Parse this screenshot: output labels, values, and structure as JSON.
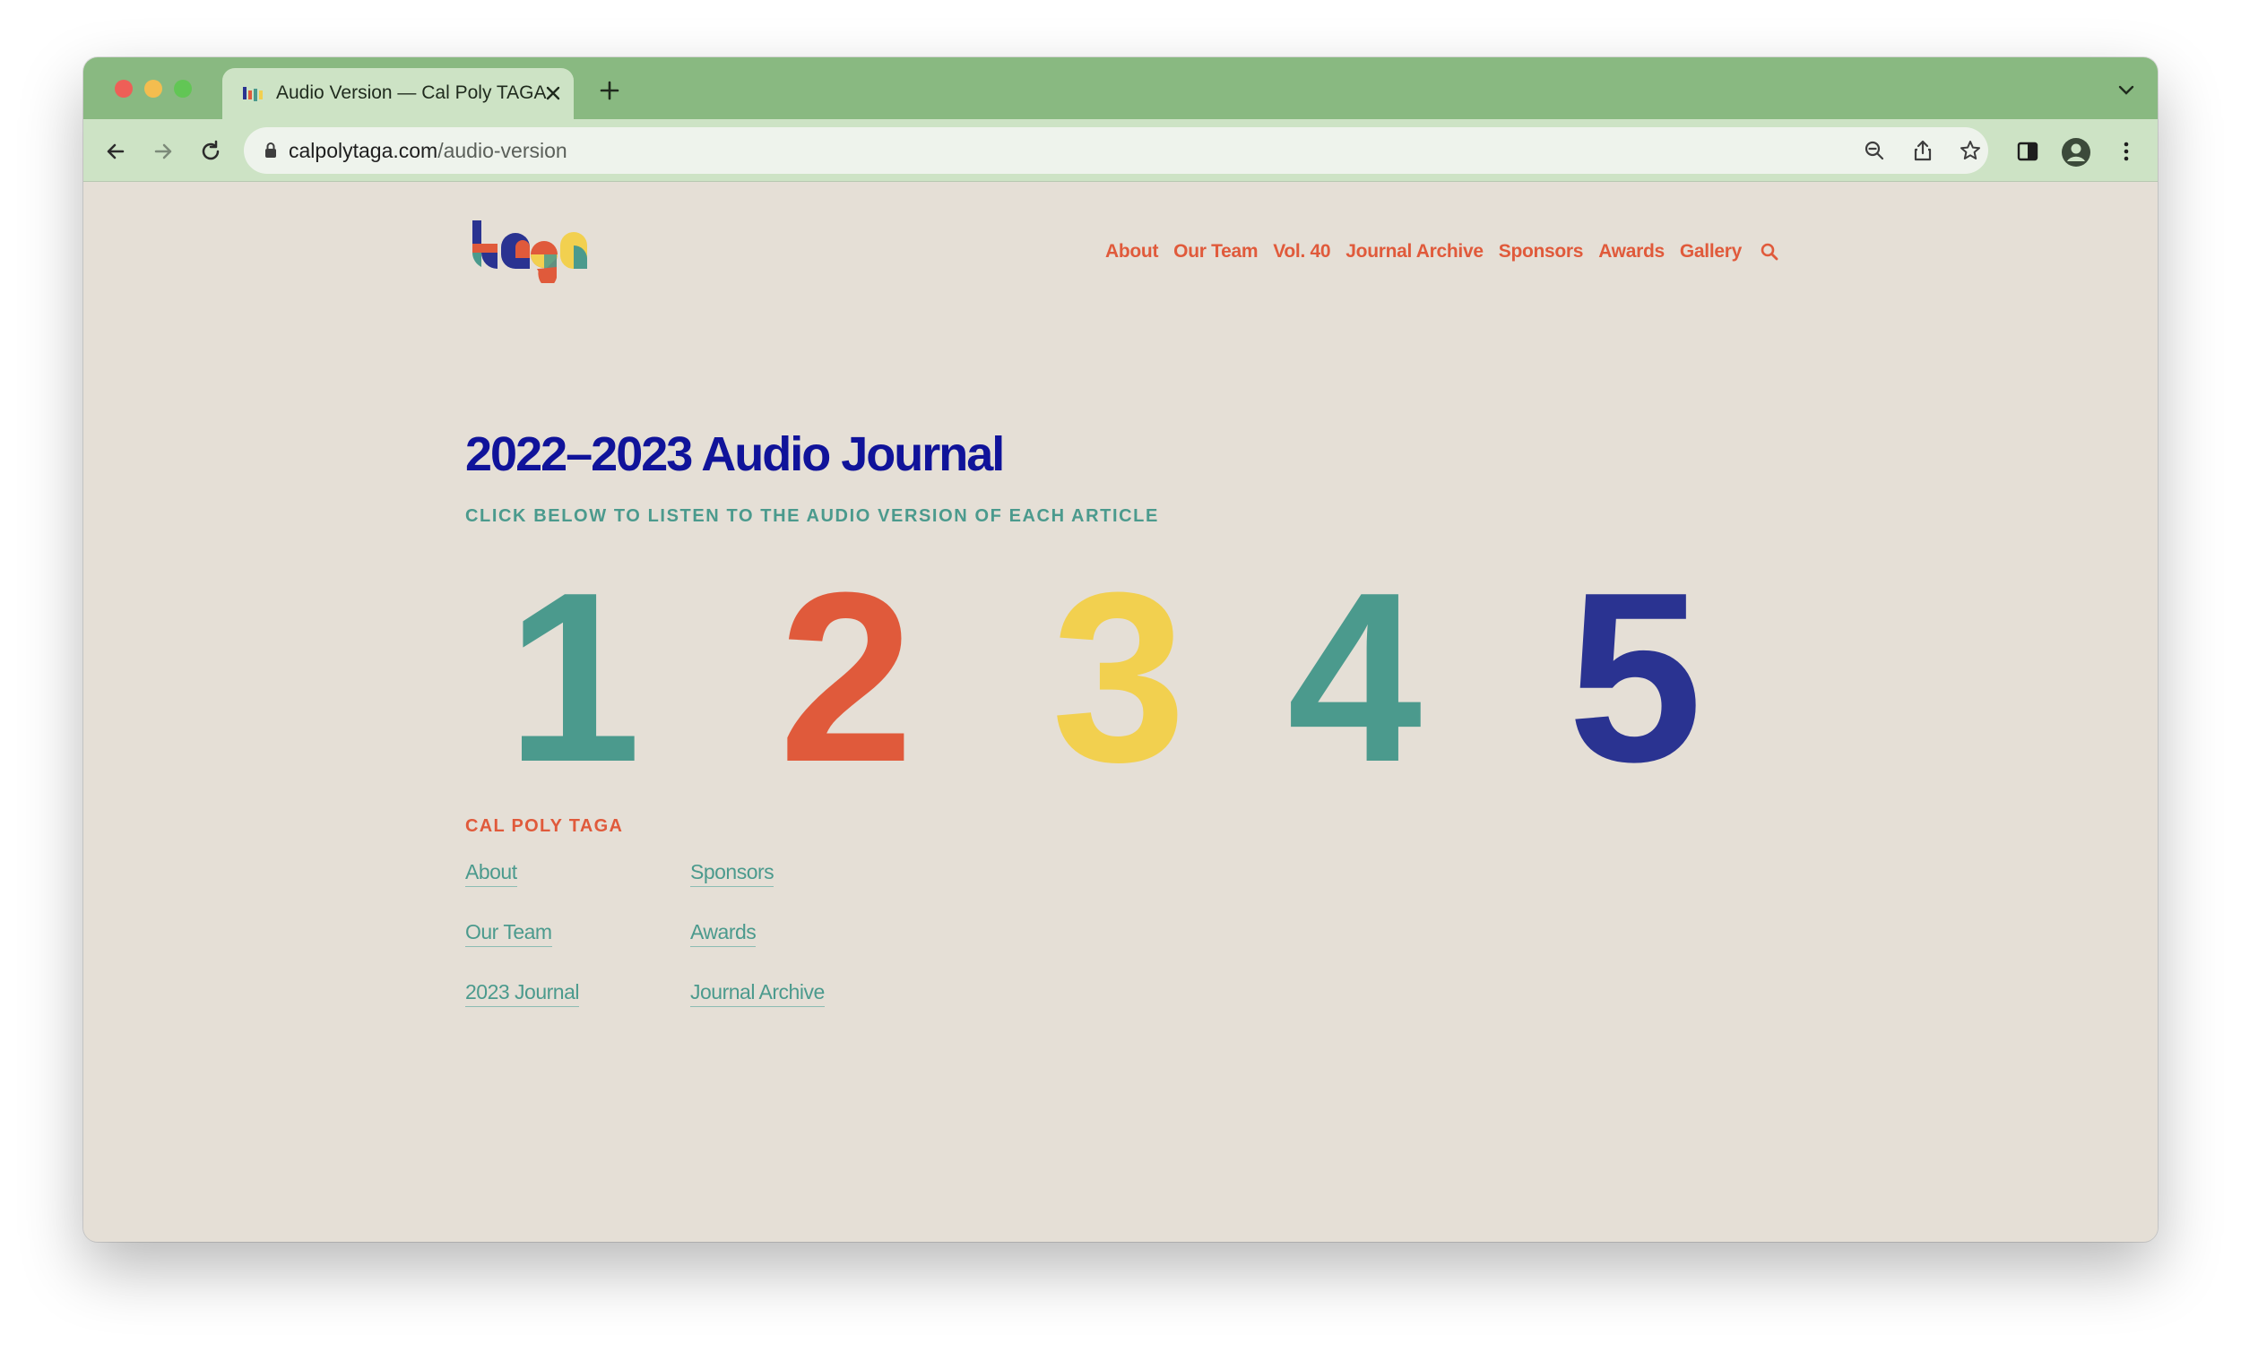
{
  "browser": {
    "tab_title": "Audio Version — Cal Poly TAGA",
    "url_host": "calpolytaga.com",
    "url_path": "/audio-version",
    "chrome_color": "#89b981",
    "toolbar_color": "#cde3c5"
  },
  "icons": {
    "back": "back-arrow-icon",
    "forward": "forward-arrow-icon",
    "reload": "reload-icon",
    "lock": "lock-icon",
    "zoom": "zoom-out-icon",
    "share": "share-icon",
    "bookmark": "star-icon",
    "side_panel": "side-panel-icon",
    "profile": "profile-icon",
    "menu": "kebab-menu-icon",
    "site_search": "search-icon"
  },
  "site": {
    "nav": [
      {
        "label": "About"
      },
      {
        "label": "Our Team"
      },
      {
        "label": "Vol. 40"
      },
      {
        "label": "Journal Archive"
      },
      {
        "label": "Sponsors"
      },
      {
        "label": "Awards"
      },
      {
        "label": "Gallery"
      }
    ],
    "accent_colors": {
      "orange": "#e05a3b",
      "teal": "#4b9a8d",
      "yellow": "#f2d04f",
      "navy": "#2a3391",
      "title_blue": "#10139a",
      "background": "#e5dfd6"
    }
  },
  "main": {
    "title": "2022–2023 Audio Journal",
    "subtitle": "CLICK BELOW TO LISTEN TO THE AUDIO VERSION OF EACH ARTICLE",
    "articles": [
      "1",
      "2",
      "3",
      "4",
      "5"
    ]
  },
  "footer": {
    "heading": "CAL POLY TAGA",
    "links": [
      "About",
      "Our Team",
      "2023 Journal",
      "Sponsors",
      "Awards",
      "Journal Archive"
    ]
  }
}
